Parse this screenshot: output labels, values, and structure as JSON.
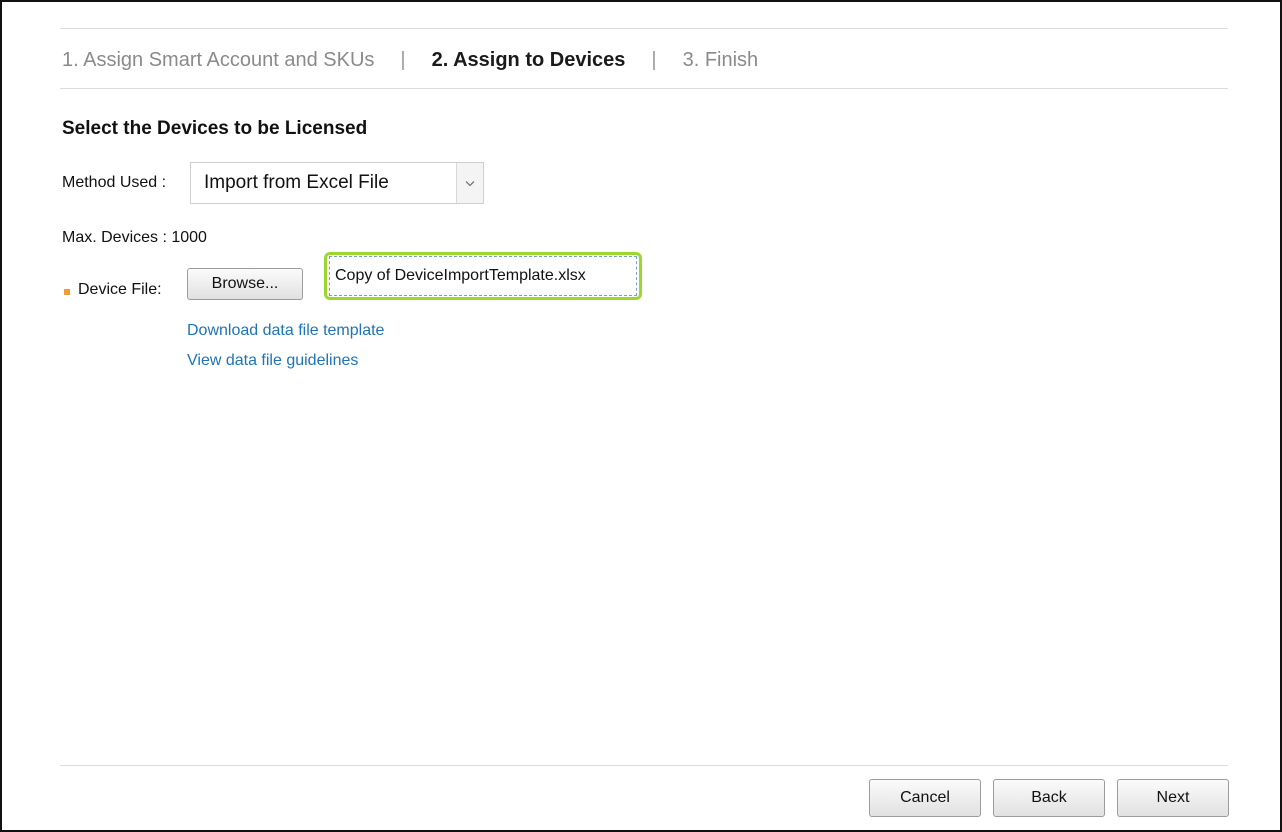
{
  "wizard": {
    "steps": [
      {
        "label": "1. Assign Smart Account and SKUs",
        "active": false
      },
      {
        "label": "2. Assign to Devices",
        "active": true
      },
      {
        "label": "3. Finish",
        "active": false
      }
    ],
    "separator": "|"
  },
  "section": {
    "title": "Select the Devices to be Licensed"
  },
  "method": {
    "label": "Method Used :",
    "selected": "Import from Excel File"
  },
  "max_devices": {
    "text": "Max. Devices : 1000"
  },
  "device_file": {
    "label": "Device File:",
    "browse_label": "Browse...",
    "file_name": "Copy of DeviceImportTemplate.xlsx"
  },
  "links": {
    "download_template": "Download data file template",
    "guidelines": "View data file guidelines"
  },
  "footer": {
    "cancel_label": "Cancel",
    "back_label": "Back",
    "next_label": "Next"
  },
  "colors": {
    "required_marker": "#f39c34",
    "link": "#1f73b7",
    "highlight": "#9bd82b"
  },
  "icons": {
    "dropdown": "chevron-down-icon"
  }
}
